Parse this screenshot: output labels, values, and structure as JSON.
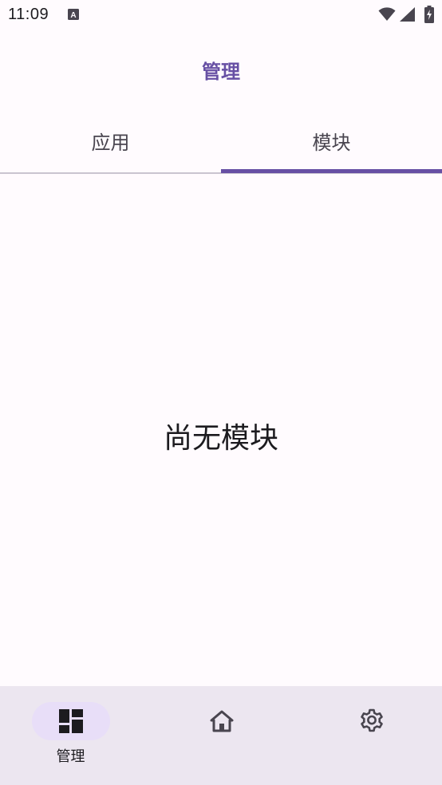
{
  "status_bar": {
    "time": "11:09",
    "notification_icon": "text-a-icon",
    "wifi_icon": "wifi-icon",
    "signal_icon": "cell-signal-icon",
    "battery_icon": "battery-charging-icon"
  },
  "app_bar": {
    "title": "管理"
  },
  "tabs": [
    {
      "label": "应用",
      "selected": false
    },
    {
      "label": "模块",
      "selected": true
    }
  ],
  "content": {
    "empty_message": "尚无模块"
  },
  "bottom_nav": {
    "items": [
      {
        "label": "管理",
        "icon": "dashboard-icon",
        "active": true
      },
      {
        "label": "",
        "icon": "home-icon",
        "active": false
      },
      {
        "label": "",
        "icon": "settings-gear-icon",
        "active": false
      }
    ]
  },
  "colors": {
    "primary": "#6750a4",
    "background": "#fffbfe",
    "nav_background": "#ece6f0",
    "active_pill": "#e8def8",
    "on_surface": "#1c1b1f",
    "on_surface_variant": "#49454f"
  }
}
